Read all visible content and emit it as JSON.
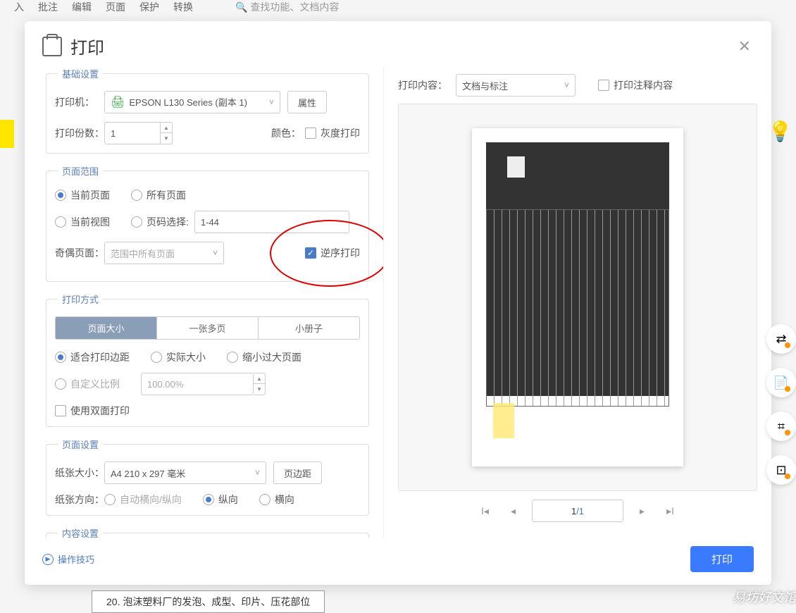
{
  "topMenu": [
    "入",
    "批注",
    "编辑",
    "页面",
    "保护",
    "转换"
  ],
  "searchHint": "查找功能、文档内容",
  "dialog": {
    "title": "打印",
    "basic": {
      "legend": "基础设置",
      "printerLabel": "打印机：",
      "printerValue": "EPSON L130 Series (副本 1)",
      "propsBtn": "属性",
      "copiesLabel": "打印份数：",
      "copiesValue": "1",
      "colorLabel": "颜色：",
      "grayLabel": "灰度打印"
    },
    "range": {
      "legend": "页面范围",
      "currentPage": "当前页面",
      "allPages": "所有页面",
      "currentView": "当前视图",
      "pageSelect": "页码选择:",
      "pageValue": "1-44",
      "oddEvenLabel": "奇偶页面：",
      "oddEvenValue": "范围中所有页面",
      "reverseLabel": "逆序打印"
    },
    "method": {
      "legend": "打印方式",
      "tab1": "页面大小",
      "tab2": "一张多页",
      "tab3": "小册子",
      "fitMargin": "适合打印边距",
      "actualSize": "实际大小",
      "shrink": "缩小过大页面",
      "customScale": "自定义比例",
      "scaleValue": "100.00%",
      "duplex": "使用双面打印"
    },
    "page": {
      "legend": "页面设置",
      "sizeLabel": "纸张大小：",
      "sizeValue": "A4 210 x 297 毫米",
      "marginBtn": "页边距",
      "orientLabel": "纸张方向：",
      "auto": "自动横向/纵向",
      "portrait": "纵向",
      "landscape": "横向"
    },
    "content": {
      "legend": "内容设置"
    },
    "preview": {
      "contentLabel": "打印内容：",
      "contentValue": "文档与标注",
      "annotLabel": "打印注释内容",
      "pageNum": "1",
      "pageTotal": "/1"
    },
    "tipsLink": "操作技巧",
    "printBtn": "打印"
  },
  "bottomText": "20. 泡沫塑料厂的发泡、成型、印片、压花部位",
  "watermark": "易坊好文馆"
}
